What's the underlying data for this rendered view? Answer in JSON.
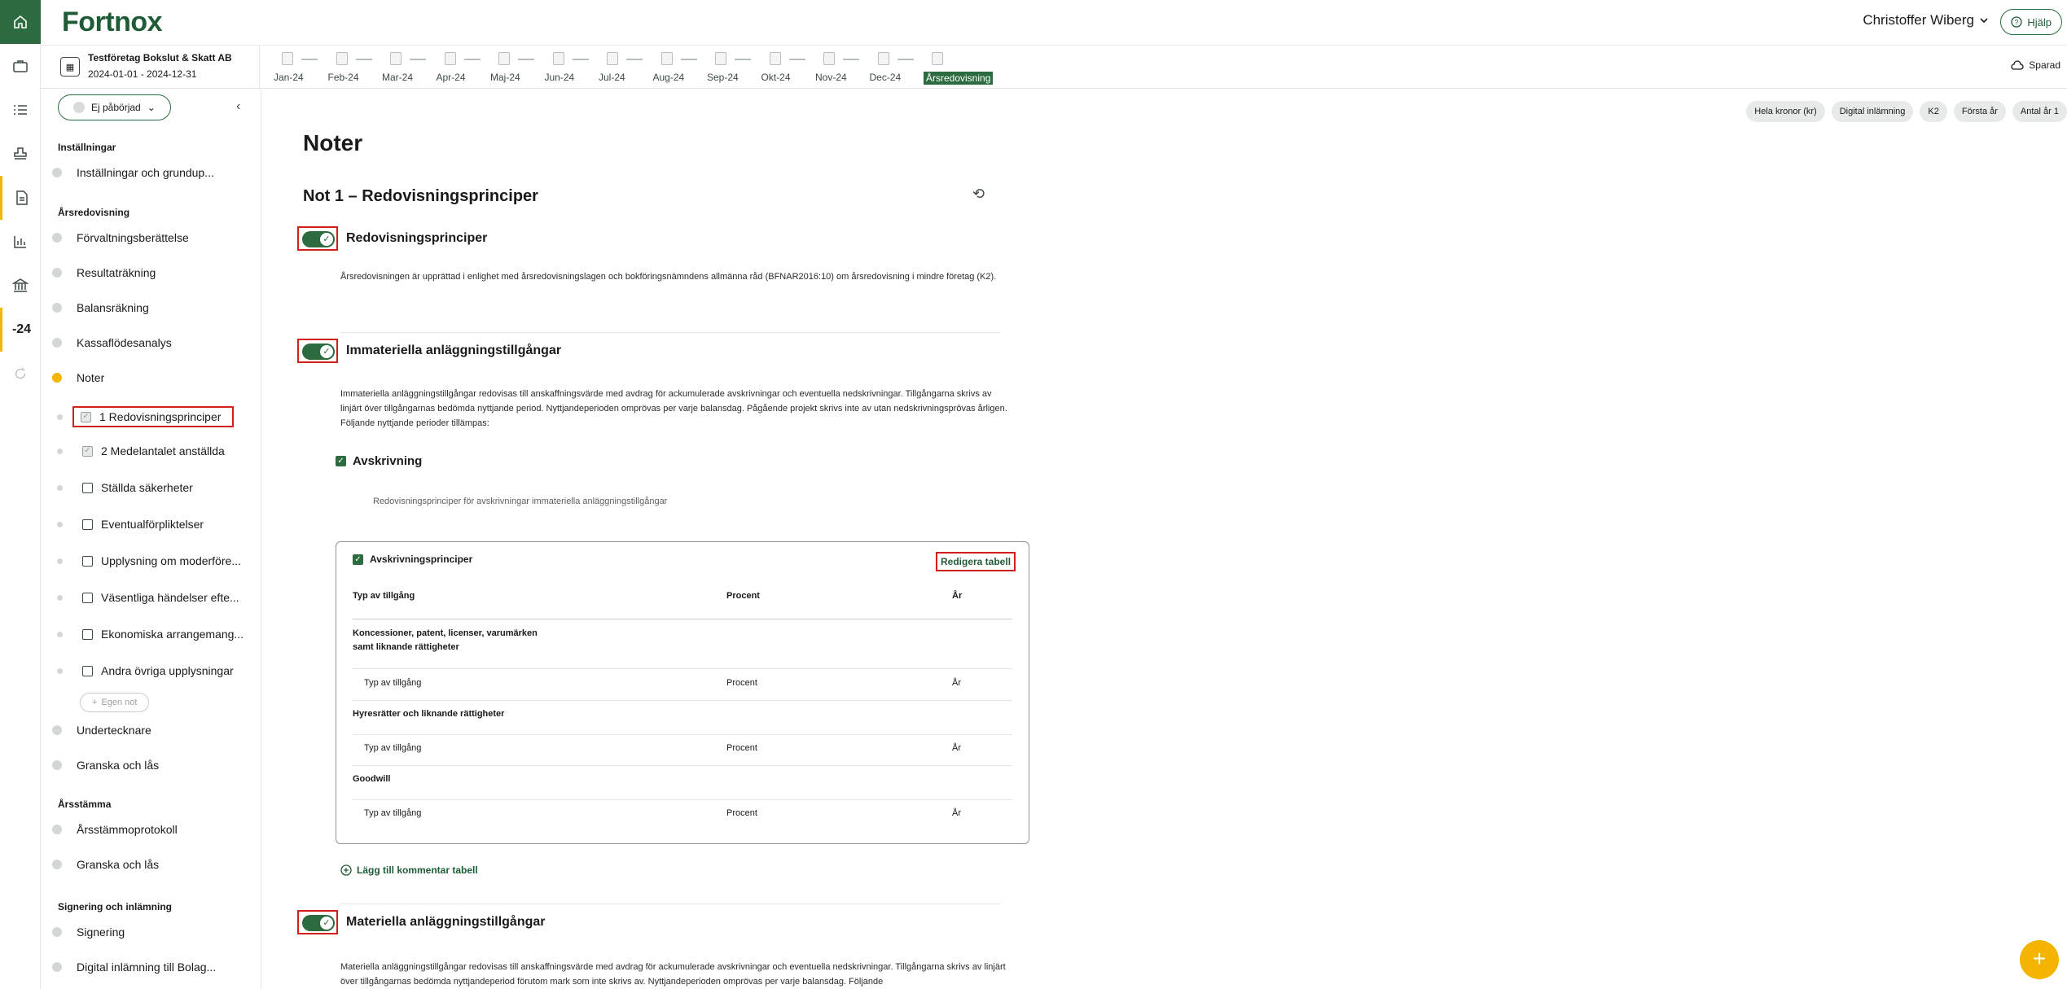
{
  "brand": {
    "logo": "Fortnox"
  },
  "header": {
    "user_name": "Christoffer Wiberg",
    "help_label": "Hjälp"
  },
  "company": {
    "name": "Testföretag Bokslut & Skatt AB",
    "period": "2024-01-01 - 2024-12-31"
  },
  "months": [
    "Jan-24",
    "Feb-24",
    "Mar-24",
    "Apr-24",
    "Maj-24",
    "Jun-24",
    "Jul-24",
    "Aug-24",
    "Sep-24",
    "Okt-24",
    "Nov-24",
    "Dec-24",
    "Årsredovisning"
  ],
  "saved_label": "Sparad",
  "rail": {
    "year_label": "-24"
  },
  "sidebar": {
    "status": "Ej påbörjad",
    "egen_not": "Egen not",
    "sections": {
      "installningar": "Inställningar",
      "arsredovisning": "Årsredovisning",
      "arsstamma": "Årsstämma",
      "signering": "Signering och inlämning"
    },
    "items": {
      "installningar_item": "Inställningar och grundup...",
      "forvaltning": "Förvaltningsberättelse",
      "resultat": "Resultaträkning",
      "balans": "Balansräkning",
      "kassaflode": "Kassaflödesanalys",
      "noter": "Noter",
      "undertecknare": "Undertecknare",
      "granska1": "Granska och lås",
      "stammoprotokoll": "Årsstämmoprotokoll",
      "granska2": "Granska och lås",
      "signering_item": "Signering",
      "digital": "Digital inlämning till Bolag..."
    },
    "notes": [
      "1 Redovisningsprinciper",
      "2 Medelantalet anställda",
      "Ställda säkerheter",
      "Eventualförpliktelser",
      "Upplysning om moderföre...",
      "Väsentliga händelser efte...",
      "Ekonomiska arrangemang...",
      "Andra övriga upplysningar"
    ]
  },
  "chips": [
    "Hela kronor (kr)",
    "Digital inlämning",
    "K2",
    "Första år",
    "Antal år 1"
  ],
  "main": {
    "title": "Noter",
    "note_title": "Not 1 – Redovisningsprinciper",
    "s1": {
      "heading": "Redovisningsprinciper",
      "text": "Årsredovisningen är upprättad i enlighet med årsredovisningslagen och bokföringsnämndens allmänna råd (BFNAR2016:10) om årsredovisning i mindre företag (K2)."
    },
    "s2": {
      "heading": "Immateriella anläggningstillgångar",
      "text": "Immateriella anläggningstillgångar redovisas till anskaffningsvärde med avdrag för ackumulerade avskrivningar och eventuella nedskrivningar. Tillgångarna skrivs av linjärt över tillgångarnas bedömda nyttjande period. Nyttjandeperioden omprövas per varje balansdag. Pågående projekt skrivs inte av utan nedskrivningsprövas årligen. Följande nyttjande perioder tillämpas:",
      "avskrivning": "Avskrivning",
      "avskrivning_sub": "Redovisningsprinciper för avskrivningar immateriella anläggningstillgångar"
    },
    "table": {
      "title": "Avskrivningsprinciper",
      "edit": "Redigera tabell",
      "headers": [
        "Typ av tillgång",
        "Procent",
        "År"
      ],
      "groups": [
        {
          "name": "Koncessioner, patent, licenser, varumärken samt liknande rättigheter",
          "row": [
            "Typ av tillgång",
            "Procent",
            "År"
          ]
        },
        {
          "name": "Hyresrätter och liknande rättigheter",
          "row": [
            "Typ av tillgång",
            "Procent",
            "År"
          ]
        },
        {
          "name": "Goodwill",
          "row": [
            "Typ av tillgång",
            "Procent",
            "År"
          ]
        }
      ]
    },
    "add_comment": "Lägg till kommentar tabell",
    "s3": {
      "heading": "Materiella anläggningstillgångar",
      "text": "Materiella anläggningstillgångar redovisas till anskaffningsvärde med avdrag för ackumulerade avskrivningar och eventuella nedskrivningar. Tillgångarna skrivs av linjärt över tillgångarnas bedömda nyttjandeperiod förutom mark som inte skrivs av. Nyttjandeperioden omprövas per varje balansdag. Följande"
    }
  }
}
